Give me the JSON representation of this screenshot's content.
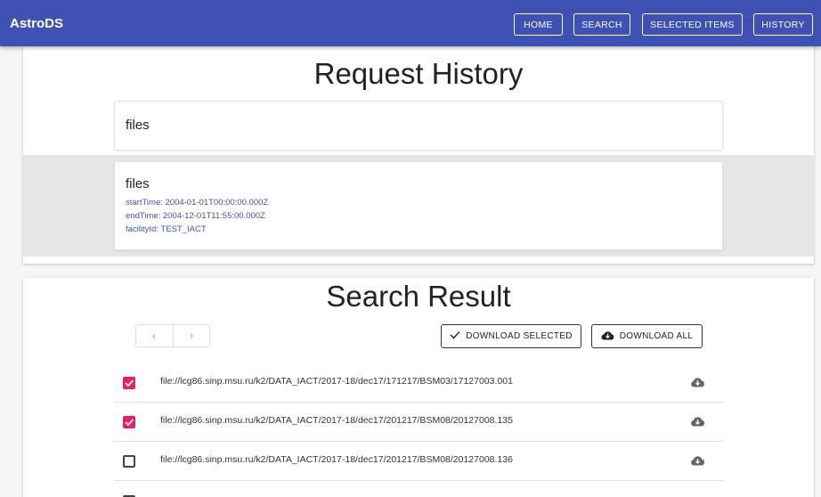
{
  "app": {
    "title": "AstroDS"
  },
  "nav": {
    "home": "HOME",
    "search": "SEARCH",
    "selected": "SELECTED ITEMS",
    "history": "HISTORY"
  },
  "history": {
    "title": "Request History",
    "items": [
      {
        "name": "files"
      },
      {
        "name": "files",
        "params": [
          "startTime: 2004-01-01T00:00:00.000Z",
          "endTime: 2004-12-01T11:55:00.000Z",
          "facilityId: TEST_IACT"
        ]
      }
    ]
  },
  "results": {
    "title": "Search Result",
    "pager": {
      "prev": "‹",
      "next": "›"
    },
    "download_selected": "DOWNLOAD SELECTED",
    "download_all": "DOWNLOAD ALL",
    "rows": [
      {
        "path": "file://lcg86.sinp.msu.ru/k2/DATA_IACT/2017-18/dec17/171217/BSM03/17127003.001",
        "checked": true
      },
      {
        "path": "file://lcg86.sinp.msu.ru/k2/DATA_IACT/2017-18/dec17/201217/BSM08/20127008.135",
        "checked": true
      },
      {
        "path": "file://lcg86.sinp.msu.ru/k2/DATA_IACT/2017-18/dec17/201217/BSM08/20127008.136",
        "checked": false
      }
    ]
  },
  "colors": {
    "primary": "#3f51b5",
    "checkbox": "#e91e63"
  }
}
